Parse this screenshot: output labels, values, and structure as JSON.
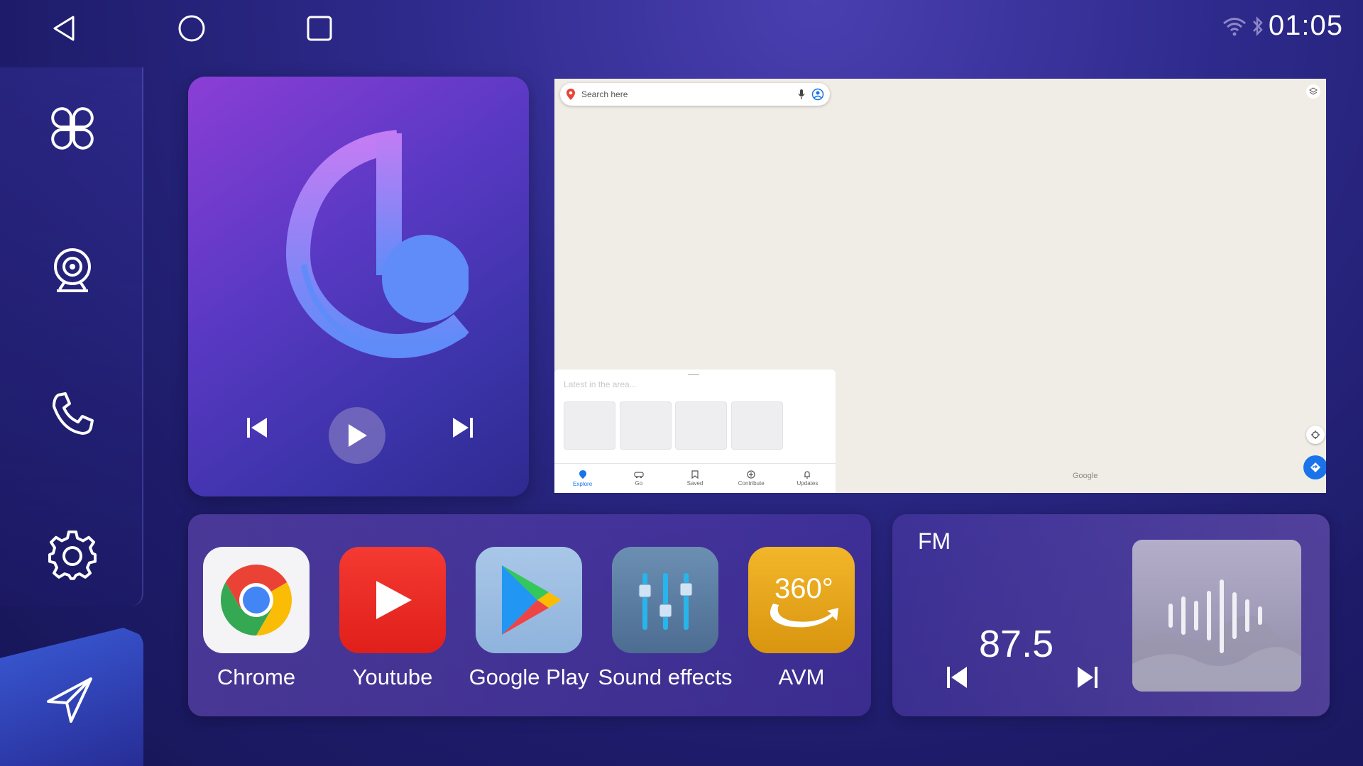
{
  "status": {
    "time": "01:05"
  },
  "nav": {
    "back": "back-icon",
    "home": "home-icon",
    "recents": "recents-icon"
  },
  "sidebar": [
    {
      "icon": "apps-grid-icon"
    },
    {
      "icon": "camera-icon"
    },
    {
      "icon": "phone-icon"
    },
    {
      "icon": "settings-icon"
    },
    {
      "icon": "navigation-icon"
    }
  ],
  "music": {
    "controls": [
      "previous",
      "play",
      "next"
    ]
  },
  "map": {
    "search_placeholder": "Search here",
    "panel_title": "Latest in the area...",
    "tabs": [
      "Explore",
      "Go",
      "Saved",
      "Contribute",
      "Updates"
    ],
    "attribution": "Google"
  },
  "apps": [
    {
      "label": "Chrome"
    },
    {
      "label": "Youtube"
    },
    {
      "label": "Google Play"
    },
    {
      "label": "Sound effects"
    },
    {
      "label": "AVM"
    }
  ],
  "avm_badge": "360°",
  "fm": {
    "band": "FM",
    "frequency": "87.5"
  }
}
